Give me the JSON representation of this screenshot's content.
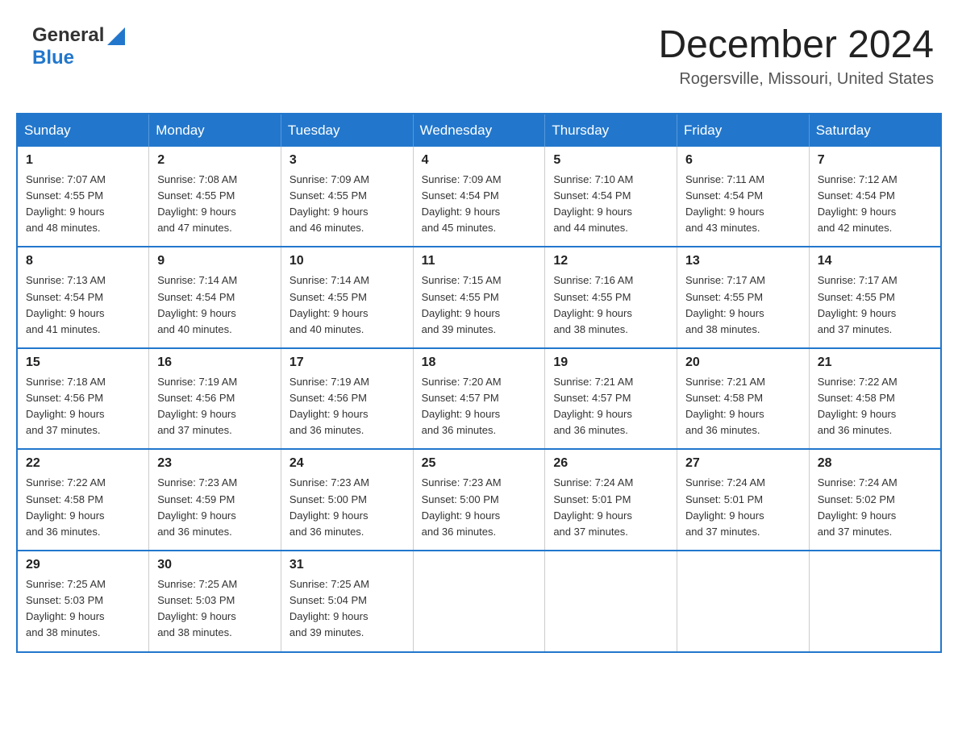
{
  "header": {
    "logo": {
      "general": "General",
      "blue": "Blue"
    },
    "title": "December 2024",
    "location": "Rogersville, Missouri, United States"
  },
  "days_of_week": [
    "Sunday",
    "Monday",
    "Tuesday",
    "Wednesday",
    "Thursday",
    "Friday",
    "Saturday"
  ],
  "weeks": [
    [
      {
        "day": "1",
        "sunrise": "7:07 AM",
        "sunset": "4:55 PM",
        "daylight": "9 hours and 48 minutes."
      },
      {
        "day": "2",
        "sunrise": "7:08 AM",
        "sunset": "4:55 PM",
        "daylight": "9 hours and 47 minutes."
      },
      {
        "day": "3",
        "sunrise": "7:09 AM",
        "sunset": "4:55 PM",
        "daylight": "9 hours and 46 minutes."
      },
      {
        "day": "4",
        "sunrise": "7:09 AM",
        "sunset": "4:54 PM",
        "daylight": "9 hours and 45 minutes."
      },
      {
        "day": "5",
        "sunrise": "7:10 AM",
        "sunset": "4:54 PM",
        "daylight": "9 hours and 44 minutes."
      },
      {
        "day": "6",
        "sunrise": "7:11 AM",
        "sunset": "4:54 PM",
        "daylight": "9 hours and 43 minutes."
      },
      {
        "day": "7",
        "sunrise": "7:12 AM",
        "sunset": "4:54 PM",
        "daylight": "9 hours and 42 minutes."
      }
    ],
    [
      {
        "day": "8",
        "sunrise": "7:13 AM",
        "sunset": "4:54 PM",
        "daylight": "9 hours and 41 minutes."
      },
      {
        "day": "9",
        "sunrise": "7:14 AM",
        "sunset": "4:54 PM",
        "daylight": "9 hours and 40 minutes."
      },
      {
        "day": "10",
        "sunrise": "7:14 AM",
        "sunset": "4:55 PM",
        "daylight": "9 hours and 40 minutes."
      },
      {
        "day": "11",
        "sunrise": "7:15 AM",
        "sunset": "4:55 PM",
        "daylight": "9 hours and 39 minutes."
      },
      {
        "day": "12",
        "sunrise": "7:16 AM",
        "sunset": "4:55 PM",
        "daylight": "9 hours and 38 minutes."
      },
      {
        "day": "13",
        "sunrise": "7:17 AM",
        "sunset": "4:55 PM",
        "daylight": "9 hours and 38 minutes."
      },
      {
        "day": "14",
        "sunrise": "7:17 AM",
        "sunset": "4:55 PM",
        "daylight": "9 hours and 37 minutes."
      }
    ],
    [
      {
        "day": "15",
        "sunrise": "7:18 AM",
        "sunset": "4:56 PM",
        "daylight": "9 hours and 37 minutes."
      },
      {
        "day": "16",
        "sunrise": "7:19 AM",
        "sunset": "4:56 PM",
        "daylight": "9 hours and 37 minutes."
      },
      {
        "day": "17",
        "sunrise": "7:19 AM",
        "sunset": "4:56 PM",
        "daylight": "9 hours and 36 minutes."
      },
      {
        "day": "18",
        "sunrise": "7:20 AM",
        "sunset": "4:57 PM",
        "daylight": "9 hours and 36 minutes."
      },
      {
        "day": "19",
        "sunrise": "7:21 AM",
        "sunset": "4:57 PM",
        "daylight": "9 hours and 36 minutes."
      },
      {
        "day": "20",
        "sunrise": "7:21 AM",
        "sunset": "4:58 PM",
        "daylight": "9 hours and 36 minutes."
      },
      {
        "day": "21",
        "sunrise": "7:22 AM",
        "sunset": "4:58 PM",
        "daylight": "9 hours and 36 minutes."
      }
    ],
    [
      {
        "day": "22",
        "sunrise": "7:22 AM",
        "sunset": "4:58 PM",
        "daylight": "9 hours and 36 minutes."
      },
      {
        "day": "23",
        "sunrise": "7:23 AM",
        "sunset": "4:59 PM",
        "daylight": "9 hours and 36 minutes."
      },
      {
        "day": "24",
        "sunrise": "7:23 AM",
        "sunset": "5:00 PM",
        "daylight": "9 hours and 36 minutes."
      },
      {
        "day": "25",
        "sunrise": "7:23 AM",
        "sunset": "5:00 PM",
        "daylight": "9 hours and 36 minutes."
      },
      {
        "day": "26",
        "sunrise": "7:24 AM",
        "sunset": "5:01 PM",
        "daylight": "9 hours and 37 minutes."
      },
      {
        "day": "27",
        "sunrise": "7:24 AM",
        "sunset": "5:01 PM",
        "daylight": "9 hours and 37 minutes."
      },
      {
        "day": "28",
        "sunrise": "7:24 AM",
        "sunset": "5:02 PM",
        "daylight": "9 hours and 37 minutes."
      }
    ],
    [
      {
        "day": "29",
        "sunrise": "7:25 AM",
        "sunset": "5:03 PM",
        "daylight": "9 hours and 38 minutes."
      },
      {
        "day": "30",
        "sunrise": "7:25 AM",
        "sunset": "5:03 PM",
        "daylight": "9 hours and 38 minutes."
      },
      {
        "day": "31",
        "sunrise": "7:25 AM",
        "sunset": "5:04 PM",
        "daylight": "9 hours and 39 minutes."
      },
      null,
      null,
      null,
      null
    ]
  ],
  "labels": {
    "sunrise": "Sunrise:",
    "sunset": "Sunset:",
    "daylight": "Daylight:"
  }
}
